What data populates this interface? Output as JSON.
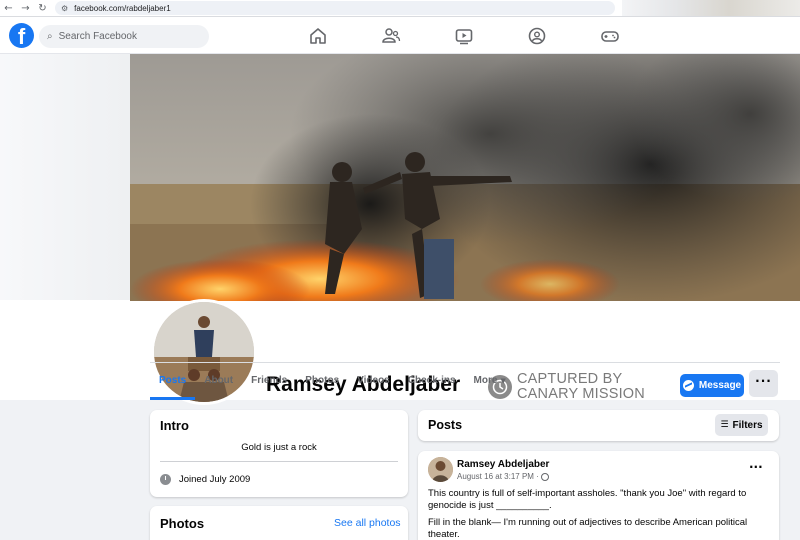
{
  "browser": {
    "url": "facebook.com/rabdeljaber1",
    "back_glyph": "←",
    "forward_glyph": "→",
    "reload_glyph": "↻"
  },
  "topbar": {
    "logo": "f",
    "search_placeholder": "Search Facebook",
    "nav_icons": [
      "home-icon",
      "friends-icon",
      "video-icon",
      "groups-icon",
      "gaming-icon"
    ]
  },
  "profile": {
    "name": "Ramsey Abdeljaber",
    "watermark_line1": "CAPTURED BY",
    "watermark_line2": "CANARY MISSION",
    "message_label": "Message",
    "tabs": [
      "Posts",
      "About",
      "Friends",
      "Photos",
      "Videos",
      "Check-ins",
      "More"
    ],
    "active_tab": "Posts",
    "more_dots": "···"
  },
  "intro": {
    "title": "Intro",
    "bio": "Gold is just a rock",
    "joined": "Joined July 2009"
  },
  "photos": {
    "title": "Photos",
    "see_all": "See all photos"
  },
  "posts": {
    "title": "Posts",
    "filters_label": "Filters",
    "items": [
      {
        "author": "Ramsey Abdeljaber",
        "time": "August 16 at 3:17 PM ·",
        "text1": "This country is full of self-important assholes. \"thank you Joe\" with regard to genocide is just __________.",
        "text2": "Fill in the blank— I'm running out of adjectives to describe American political theater."
      }
    ]
  },
  "colors": {
    "brand": "#1877f2",
    "background": "#f0f2f5"
  }
}
